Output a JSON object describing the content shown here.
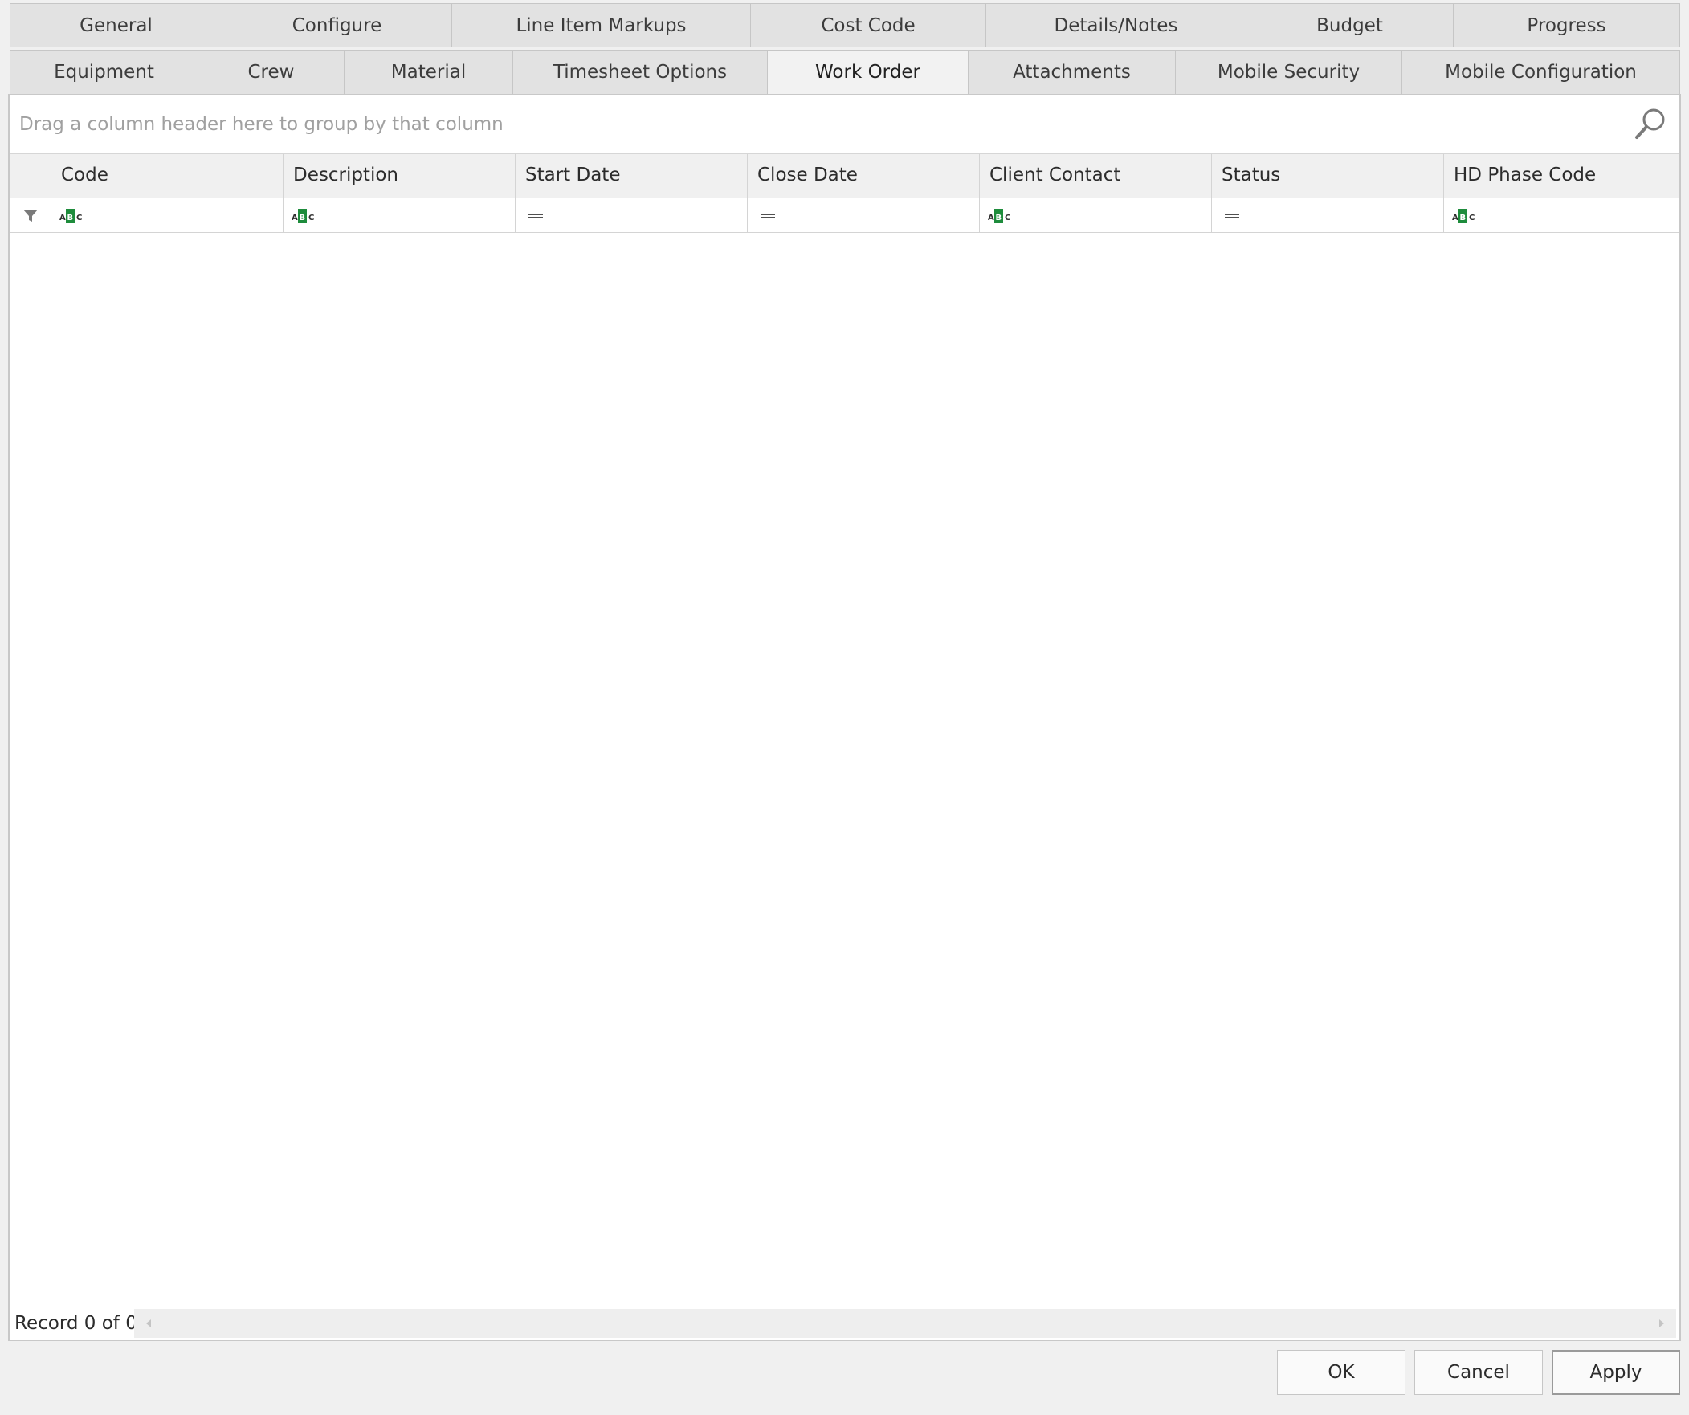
{
  "tabs": {
    "row1": [
      {
        "label": "General"
      },
      {
        "label": "Configure"
      },
      {
        "label": "Line Item Markups"
      },
      {
        "label": "Cost Code"
      },
      {
        "label": "Details/Notes"
      },
      {
        "label": "Budget"
      },
      {
        "label": "Progress"
      }
    ],
    "row2": [
      {
        "label": "Equipment"
      },
      {
        "label": "Crew"
      },
      {
        "label": "Material"
      },
      {
        "label": "Timesheet Options"
      },
      {
        "label": "Work Order"
      },
      {
        "label": "Attachments"
      },
      {
        "label": "Mobile Security"
      },
      {
        "label": "Mobile Configuration"
      }
    ],
    "active": "Work Order"
  },
  "grid": {
    "group_panel_text": "Drag a column header here to group by that column",
    "search_icon": "magnifier-icon",
    "columns": [
      {
        "label": "Code",
        "filter_type": "text"
      },
      {
        "label": "Description",
        "filter_type": "text"
      },
      {
        "label": "Start Date",
        "filter_type": "equals"
      },
      {
        "label": "Close Date",
        "filter_type": "equals"
      },
      {
        "label": "Client Contact",
        "filter_type": "text"
      },
      {
        "label": "Status",
        "filter_type": "equals"
      },
      {
        "label": "HD Phase Code",
        "filter_type": "text"
      }
    ],
    "rows": [],
    "record_label": "Record 0 of 0"
  },
  "buttons": {
    "ok": "OK",
    "cancel": "Cancel",
    "apply": "Apply"
  },
  "colors": {
    "text_filter_icon": "#1e8c3c",
    "active_tab": "#f2f2f2",
    "inactive_tab": "#e2e2e2"
  }
}
